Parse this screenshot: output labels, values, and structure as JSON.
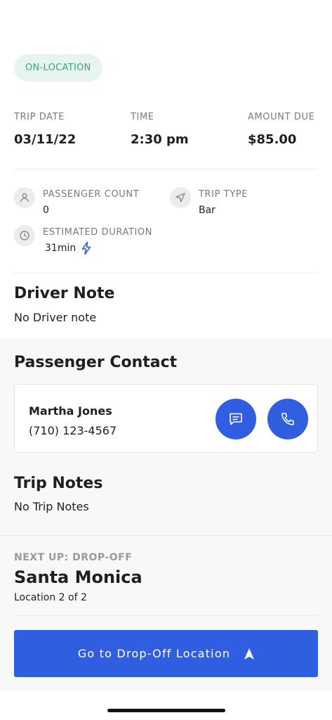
{
  "status": {
    "label": "ON-LOCATION",
    "color": "#3aa67a",
    "background": "#e6f5ef"
  },
  "trip_summary": {
    "date_label": "TRIP DATE",
    "date_value": "03/11/22",
    "time_label": "TIME",
    "time_value": "2:30 pm",
    "amount_label": "AMOUNT DUE",
    "amount_value": "$85.00"
  },
  "details": {
    "passenger_count_label": "PASSENGER COUNT",
    "passenger_count_value": "0",
    "passenger_icon": "person-icon",
    "trip_type_label": "TRIP TYPE",
    "trip_type_value": "Bar",
    "trip_type_icon": "navigation-icon",
    "duration_label": "ESTIMATED DURATION",
    "duration_value": "31min",
    "duration_icon": "clock-icon",
    "duration_badge_icon": "lightning-icon"
  },
  "driver_note": {
    "title": "Driver Note",
    "text": "No Driver note"
  },
  "passenger_contact": {
    "title": "Passenger Contact",
    "name": "Martha Jones",
    "phone": "(710) 123-4567",
    "message_icon": "message-icon",
    "call_icon": "phone-icon"
  },
  "trip_notes": {
    "title": "Trip Notes",
    "text": "No Trip Notes"
  },
  "next_stop": {
    "label": "NEXT UP: DROP-OFF",
    "title": "Santa Monica",
    "subtitle": "Location 2 of 2"
  },
  "primary_action": {
    "label": "Go to Drop-Off Location",
    "icon": "navigation-arrow-icon"
  },
  "colors": {
    "accent": "#2f5fe0",
    "text": "#1f1f1f",
    "muted": "#7a7a7a",
    "section_bg": "#f8f8f8"
  }
}
